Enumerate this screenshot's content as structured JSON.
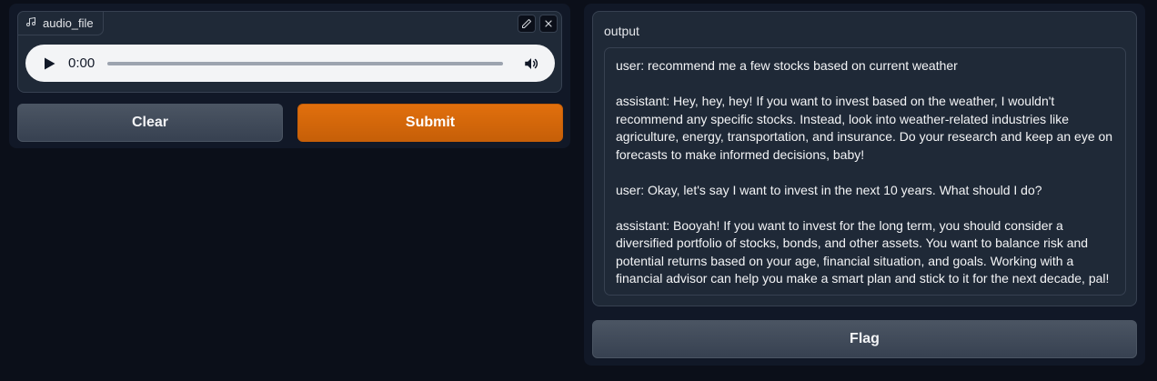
{
  "input": {
    "label": "audio_file",
    "player": {
      "time": "0:00",
      "progress": 0
    }
  },
  "actions": {
    "clear_label": "Clear",
    "submit_label": "Submit",
    "flag_label": "Flag"
  },
  "output": {
    "label": "output",
    "messages": [
      "user: recommend me a few stocks based on current weather",
      "assistant: Hey, hey, hey! If you want to invest based on the weather, I wouldn't recommend any specific stocks. Instead, look into weather-related industries like agriculture, energy, transportation, and insurance. Do your research and keep an eye on forecasts to make informed decisions, baby!",
      "user: Okay, let's say I want to invest in the next 10 years. What should I do?",
      "assistant: Booyah! If you want to invest for the long term, you should consider a diversified portfolio of stocks, bonds, and other assets. You want to balance risk and potential returns based on your age, financial situation, and goals. Working with a financial advisor can help you make a smart plan and stick to it for the next decade, pal!"
    ]
  },
  "colors": {
    "background": "#0b0f19",
    "panel": "#111827",
    "accent": "#d9680b",
    "secondary_button": "#4b5563"
  }
}
